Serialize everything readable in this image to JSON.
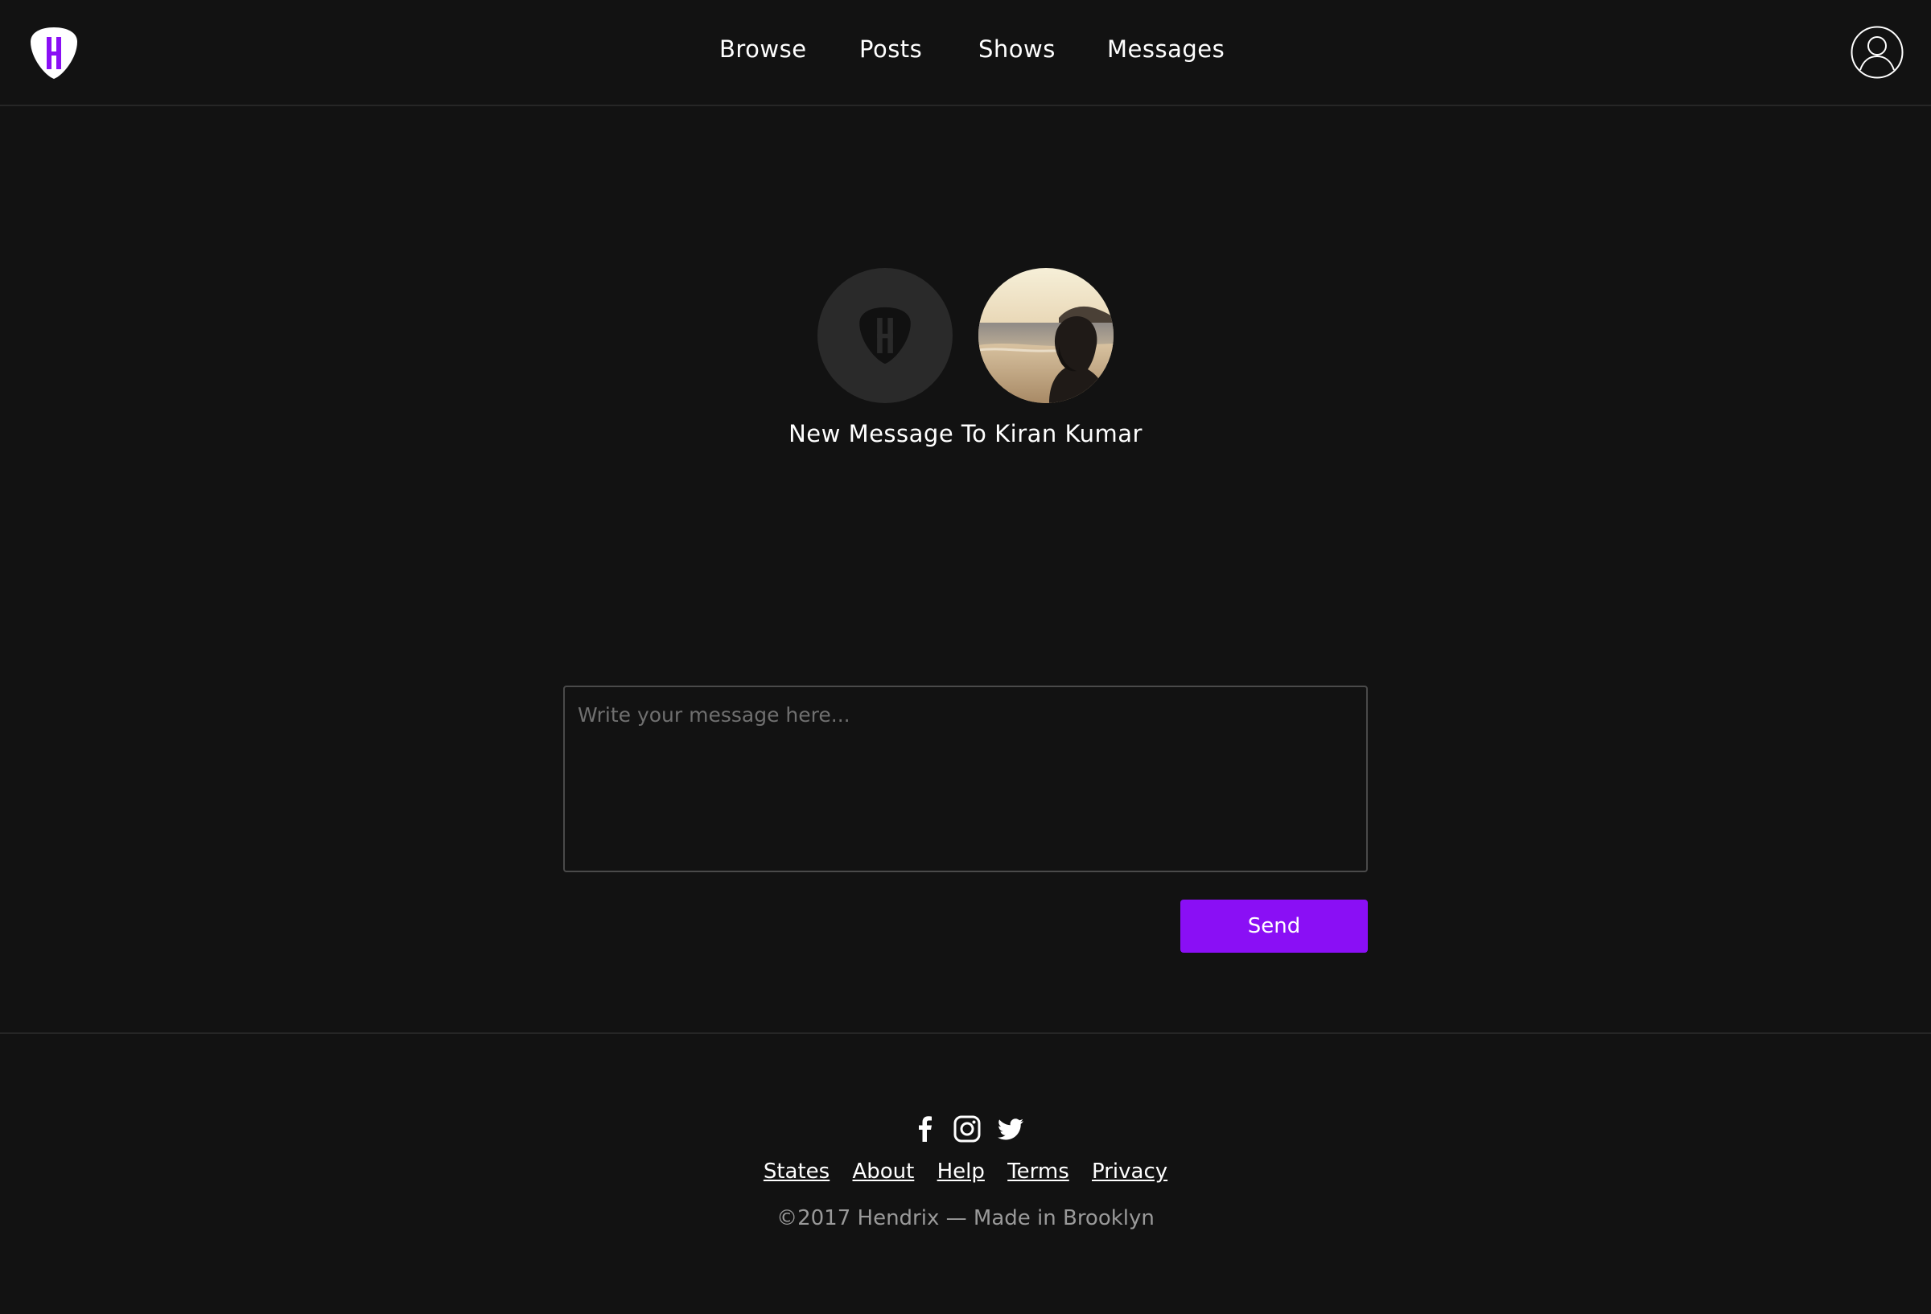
{
  "header": {
    "nav": {
      "browse": "Browse",
      "posts": "Posts",
      "shows": "Shows",
      "messages": "Messages"
    }
  },
  "compose": {
    "title": "New Message To Kiran Kumar",
    "placeholder": "Write your message here...",
    "value": "",
    "send_label": "Send"
  },
  "footer": {
    "social_icons": [
      "facebook-icon",
      "instagram-icon",
      "twitter-icon"
    ],
    "links": {
      "states": "States",
      "about": "About",
      "help": "Help",
      "terms": "Terms",
      "privacy": "Privacy"
    },
    "copyright": "©2017 Hendrix — Made in Brooklyn"
  },
  "colors": {
    "background": "#121212",
    "accent": "#8a0ff5",
    "divider": "#262626",
    "muted_text": "#9a9a9a"
  }
}
